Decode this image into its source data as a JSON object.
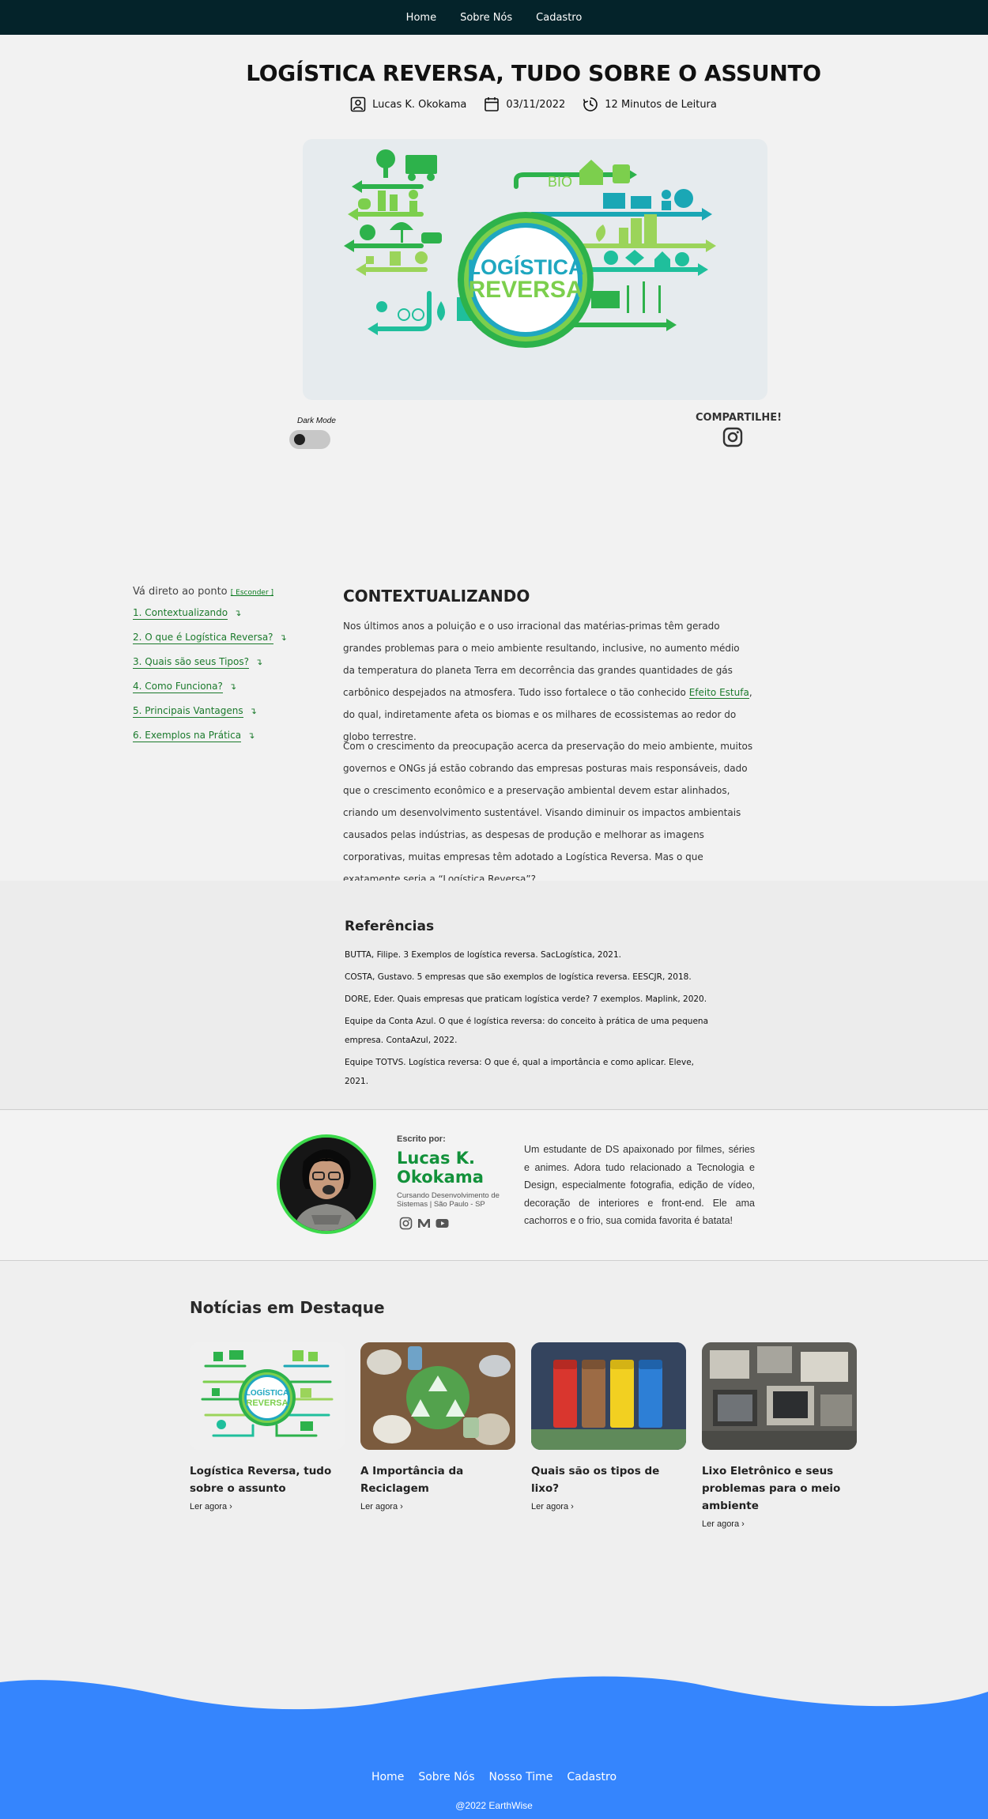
{
  "nav": {
    "items": [
      "Home",
      "Sobre Nós",
      "Cadastro"
    ]
  },
  "article": {
    "title": "LOGÍSTICA REVERSA, TUDO SOBRE O ASSUNTO",
    "author": "Lucas K. Okokama",
    "date": "03/11/2022",
    "read_time": "12 Minutos de Leitura",
    "image_text": {
      "line1": "LOGÍSTICA",
      "line2": "REVERSA",
      "bio": "BIO"
    }
  },
  "controls": {
    "dark_mode": "Dark Mode",
    "dark_mode_on": false,
    "share": "COMPARTILHE!"
  },
  "toc": {
    "heading": "Vá direto ao ponto",
    "hide": "[ Esconder ]",
    "items": [
      "1. Contextualizando",
      "2. O que é Logística Reversa?",
      "3. Quais são seus Tipos?",
      "4. Como Funciona?",
      "5. Principais Vantagens",
      "6. Exemplos na Prática"
    ],
    "arrow": "↴"
  },
  "section": {
    "title": "CONTEXTUALIZANDO",
    "p1_before": "Nos últimos anos a poluição e o uso irracional das matérias-primas têm gerado grandes problemas para o meio ambiente resultando, inclusive, no aumento médio da temperatura do planeta Terra em decorrência das grandes quantidades de gás carbônico despejados na atmosfera. Tudo isso fortalece o tão conhecido ",
    "p1_link": "Efeito Estufa",
    "p1_after": ", do qual, indiretamente afeta os biomas e os milhares de ecossistemas ao redor do globo terrestre.",
    "p2": "Com o crescimento da preocupação acerca da preservação do meio ambiente, muitos governos e ONGs já estão cobrando das empresas posturas mais responsáveis, dado que o crescimento econômico e a preservação ambiental devem estar alinhados, criando um desenvolvimento sustentável. Visando diminuir os impactos ambientais causados pelas indústrias, as despesas de produção e melhorar as imagens corporativas, muitas empresas têm adotado a Logística Reversa. Mas o que exatamente seria a “Logística Reversa”?"
  },
  "references": {
    "title": "Referências",
    "items": [
      "BUTTA, Filipe. 3 Exemplos de logística reversa. SacLogística, 2021.",
      "COSTA, Gustavo. 5 empresas que são exemplos de logística reversa. EESCJR, 2018.",
      "DORE, Eder. Quais empresas que praticam logística verde? 7 exemplos. Maplink, 2020.",
      "Equipe da Conta Azul. O que é logística reversa: do conceito à prática de uma pequena empresa. ContaAzul, 2022.",
      "Equipe TOTVS. Logística reversa: O que é, qual a importância e como aplicar. Eleve, 2021."
    ]
  },
  "author": {
    "written_by": "Escrito por:",
    "name": "Lucas K. Okokama",
    "course": "Cursando Desenvolvimento de Sistemas | São Paulo - SP",
    "bio": "Um estudante de DS apaixonado por filmes, séries e animes. Adora tudo relacionado a Tecnologia e Design, especialmente fotografia, edição de vídeo, decoração de interiores e front-end. Ele ama cachorros e o frio, sua comida favorita é batata!",
    "social_icons": [
      "instagram-icon",
      "medium-icon",
      "youtube-icon"
    ]
  },
  "news": {
    "title": "Notícias em Destaque",
    "more_label": "Ler agora",
    "cards": [
      {
        "title": "Logística Reversa, tudo sobre o assunto",
        "thumb_text": "LOGÍSTICA REVERSA"
      },
      {
        "title": "A Importância da Reciclagem"
      },
      {
        "title": "Quais são os tipos de lixo?"
      },
      {
        "title": "Lixo Eletrônico e seus problemas para o meio ambiente"
      }
    ]
  },
  "footer": {
    "links": [
      "Home",
      "Sobre Nós",
      "Nosso Time",
      "Cadastro"
    ],
    "copyright": "@2022 EarthWise"
  },
  "colors": {
    "nav_bg": "#04232a",
    "accent_green": "#12913a",
    "footer_blue": "#3585fd"
  }
}
